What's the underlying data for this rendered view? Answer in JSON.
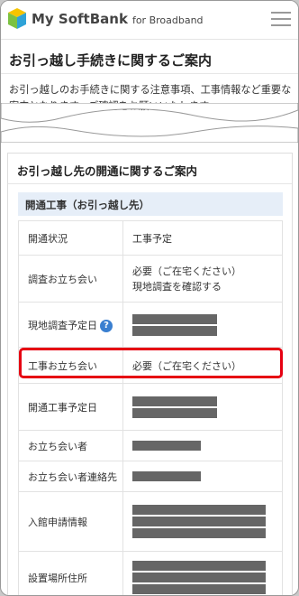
{
  "header": {
    "brand": "My SoftBank",
    "brand_sub": "for Broadband"
  },
  "page": {
    "title": "お引っ越し手続きに関するご案内",
    "intro": "お引っ越しのお手続きに関する注意事項、工事情報など重要な案内となります。ご確認をお願いいたします。"
  },
  "card": {
    "title": "お引っ越し先の開通に関するご案内",
    "section_title": "開通工事（お引っ越し先）",
    "rows": [
      {
        "label": "開通状況",
        "value": "工事予定"
      },
      {
        "label": "調査お立ち会い",
        "value": "必要（ご在宅ください）",
        "value2": "現地調査を確認する"
      },
      {
        "label": "現地調査予定日"
      },
      {
        "label": "工事お立ち会い",
        "value": "必要（ご在宅ください）"
      },
      {
        "label": "開通工事予定日"
      },
      {
        "label": "お立ち会い者"
      },
      {
        "label": "お立ち会い者連絡先"
      },
      {
        "label": "入館申請情報"
      },
      {
        "label": "設置場所住所"
      }
    ]
  },
  "icons": {
    "help": "?"
  },
  "colors": {
    "highlight": "#e60012",
    "help_icon": "#3a7fd0",
    "section_bg": "#e6eef8"
  }
}
